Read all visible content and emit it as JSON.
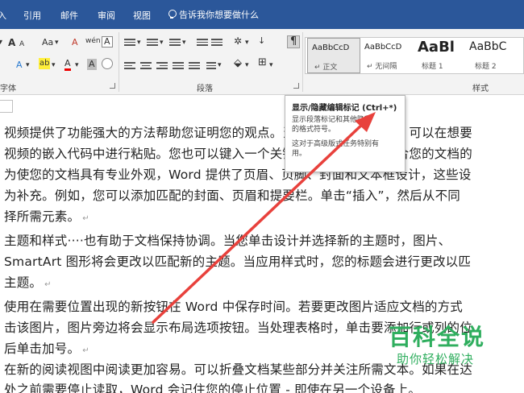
{
  "menubar": {
    "tabs": [
      "插入",
      "引用",
      "邮件",
      "审阅",
      "视图"
    ],
    "tell_me": "告诉我你想要做什么"
  },
  "ribbon": {
    "font_group_label": "字体",
    "paragraph_group_label": "段落",
    "styles_group_label": "样式",
    "font_grow": "A",
    "font_shrink": "A",
    "change_case": "Aa",
    "clear_format": "A",
    "text_effect": "A",
    "highlight": "ab",
    "font_color": "A",
    "char_shading": "A",
    "enclosed_char": "A",
    "phonetic_guide": "wén",
    "show_marks": "¶"
  },
  "styles": [
    {
      "preview": "AaBbCcD",
      "name": "↵ 正文",
      "selected": true
    },
    {
      "preview": "AaBbCcD",
      "name": "↵ 无间隔",
      "selected": false
    },
    {
      "preview": "AaBl",
      "name": "标题 1",
      "selected": false
    },
    {
      "preview": "AaBbC",
      "name": "标题 2",
      "selected": false
    }
  ],
  "tooltip": {
    "title": "显示/隐藏编辑标记 (Ctrl+*)",
    "desc": "显示段落标记和其他隐藏的格式符号。",
    "more": "这对于高级版式任务特别有用。"
  },
  "document": {
    "lines": [
      {
        "text": "视频提供了功能强大的方法帮助您证明您的观点。当您单击联机视频时，可以在想要",
        "mark": false
      },
      {
        "text": "视频的嵌入代码中进行粘贴。您也可以键入一个关键字以联机搜索最适合您的文档的",
        "mark": false
      },
      {
        "text": "为使您的文档具有专业外观，Word 提供了页眉、页脚、封面和文本框设计，这些设",
        "mark": false
      },
      {
        "text": "为补充。例如，您可以添加匹配的封面、页眉和提要栏。单击“插入”，然后从不同",
        "mark": false
      },
      {
        "text": "择所需元素。",
        "mark": true
      },
      {
        "text": "主题和样式····也有助于文档保持协调。当您单击设计并选择新的主题时，图片、",
        "mark": false
      },
      {
        "text": "SmartArt 图形将会更改以匹配新的主题。当应用样式时，您的标题会进行更改以匹",
        "mark": false
      },
      {
        "text": "主题。",
        "mark": true
      },
      {
        "text": "使用在需要位置出现的新按钮在 Word 中保存时间。若要更改图片适应文档的方式",
        "mark": false
      },
      {
        "text": "击该图片，图片旁边将会显示布局选项按钮。当处理表格时，单击要添加行或列的位",
        "mark": false
      },
      {
        "text": "后单击加号。",
        "mark": true
      },
      {
        "text": "在新的阅读视图中阅读更加容易。可以折叠文档某些部分并关注所需文本。如果在达",
        "mark": false
      },
      {
        "text": "处之前需要停止读取，Word 会记住您的停止位置 - 即使在另一个设备上。",
        "mark": false
      }
    ],
    "paragraph_mark": "↵"
  },
  "watermark": {
    "brand": "百科全说",
    "slogan": "助你轻松解决"
  },
  "colors": {
    "ribbon_blue": "#2b579a",
    "arrow_red": "#e8413c",
    "watermark_green": "#2fae5e"
  }
}
